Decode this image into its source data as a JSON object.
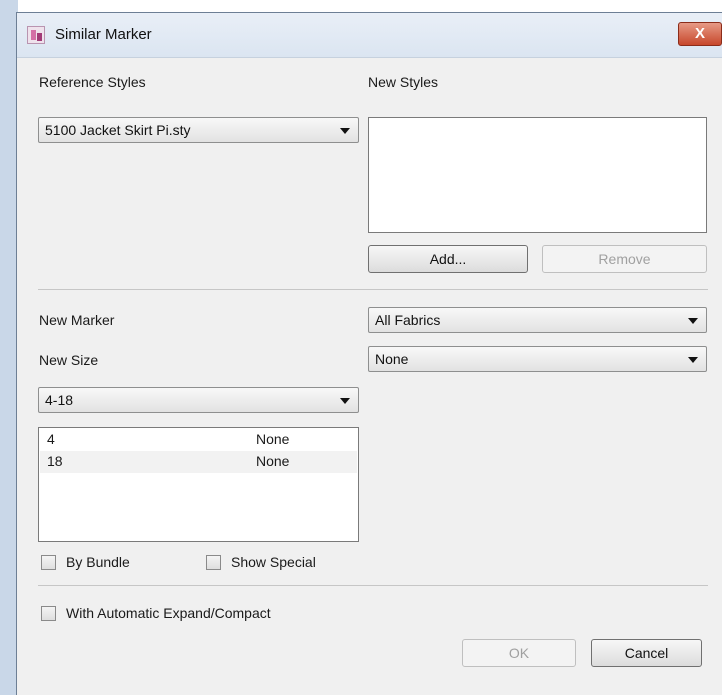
{
  "window": {
    "title": "Similar Marker",
    "close_label": "X"
  },
  "reference_styles": {
    "label": "Reference Styles",
    "selected": "5100 Jacket Skirt Pi.sty"
  },
  "new_styles": {
    "label": "New Styles",
    "add_label": "Add...",
    "remove_label": "Remove"
  },
  "new_marker": {
    "label": "New Marker",
    "selected": "All Fabrics"
  },
  "new_size": {
    "label": "New Size",
    "selected": "None"
  },
  "size_range": {
    "selected": "4-18"
  },
  "size_list": [
    {
      "size": "4",
      "value": "None"
    },
    {
      "size": "18",
      "value": "None"
    }
  ],
  "options": {
    "by_bundle": "By Bundle",
    "show_special": "Show Special",
    "auto_expand": "With Automatic Expand/Compact"
  },
  "footer": {
    "ok_label": "OK",
    "cancel_label": "Cancel"
  }
}
